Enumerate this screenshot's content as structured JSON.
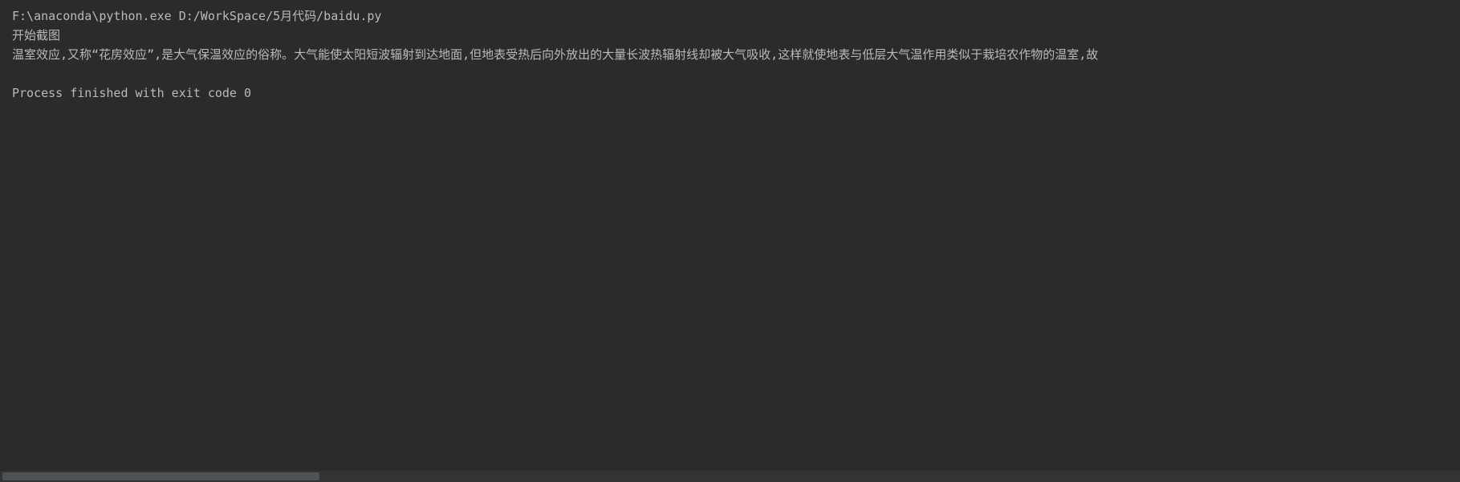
{
  "console": {
    "lines": [
      "F:\\anaconda\\python.exe D:/WorkSpace/5月代码/baidu.py",
      "开始截图",
      "温室效应,又称“花房效应”,是大气保温效应的俗称。大气能使太阳短波辐射到达地面,但地表受热后向外放出的大量长波热辐射线却被大气吸收,这样就使地表与低层大气温作用类似于栽培农作物的温室,故"
    ],
    "process_exit": "Process finished with exit code 0"
  }
}
